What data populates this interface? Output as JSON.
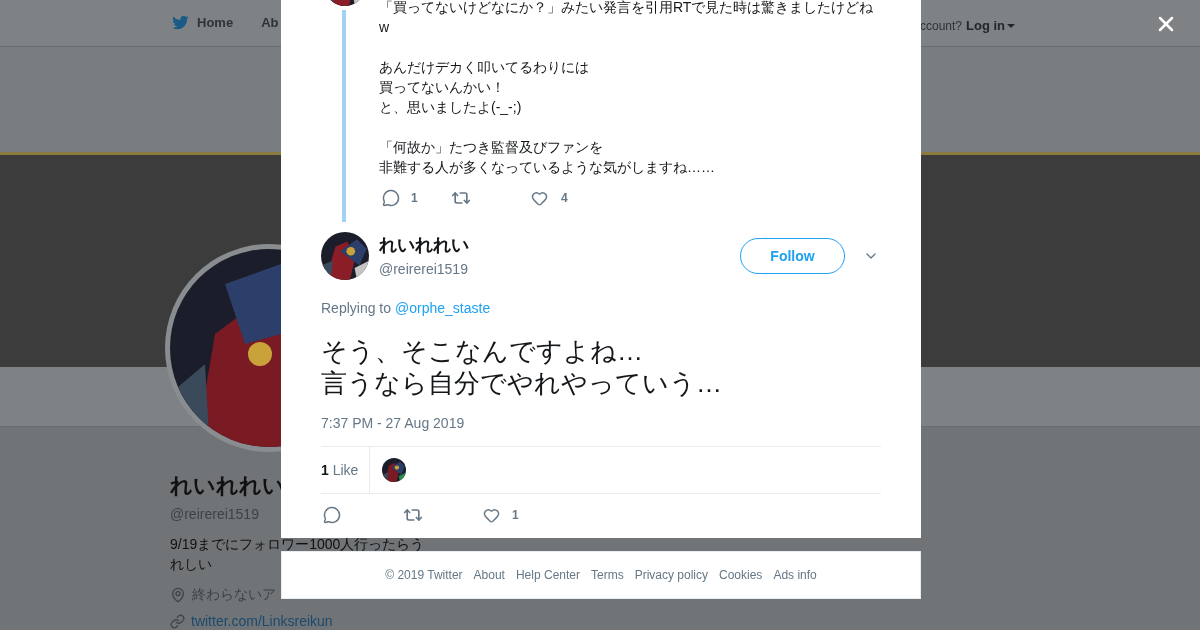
{
  "nav": {
    "items": [
      {
        "label": "Home"
      },
      {
        "label": "Ab"
      }
    ],
    "account_prompt": "ccount?",
    "login": "Log in"
  },
  "profile": {
    "name": "れいれれい",
    "handle": "@reirerei1519",
    "bio": "9/19までにフォロワー1000人行ったらうれしい",
    "location": "終わらないア",
    "link": "twitter.com/Linksreikun"
  },
  "parent_tweet": {
    "paragraphs": [
      [
        "「買ってないけどなにか？」みたい発言を引用RTで見た時は驚きましたけどねw"
      ],
      [
        "あんだけデカく叩いてるわりには",
        "買ってないんかい！",
        "と、思いましたよ(-_-;)"
      ],
      [
        "「何故か」たつき監督及びファンを",
        "非難する人が多くなっているような気がしますね……"
      ]
    ],
    "replies": "1",
    "likes": "4"
  },
  "tweet": {
    "name": "れいれれい",
    "handle": "@reirerei1519",
    "follow": "Follow",
    "replying_label": "Replying to",
    "replying_to": "@orphe_staste",
    "text_lines": [
      "そう、そこなんですよね…",
      "言うなら自分でやれやっていう…"
    ],
    "time": "7:37 PM - 27 Aug 2019",
    "like_count": "1",
    "like_label": "Like",
    "action_likes": "1"
  },
  "footer": [
    "© 2019 Twitter",
    "About",
    "Help Center",
    "Terms",
    "Privacy policy",
    "Cookies",
    "Ads info"
  ]
}
